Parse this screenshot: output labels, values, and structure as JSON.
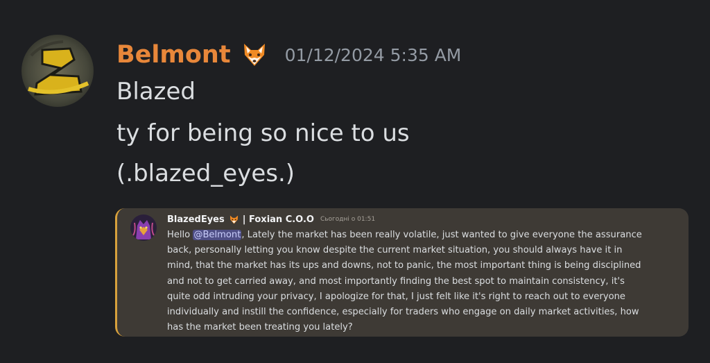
{
  "message": {
    "author": "Belmont",
    "badge_icon": "fox-emoji-icon",
    "timestamp": "01/12/2024 5:35 AM",
    "lines": [
      "Blazed",
      "ty for being so nice to us",
      "(.blazed_eyes.)"
    ],
    "colors": {
      "author": "#e8873a",
      "text": "#dbdee1",
      "timestamp": "#949ba4",
      "background": "#1e1f22"
    }
  },
  "embed": {
    "author": "BlazedEyes",
    "author_icon": "fox-emoji-icon",
    "role": "| Foxian C.O.O",
    "time": "Сьогодні о 01:51",
    "greeting": "Hello ",
    "mention": "@Belmont",
    "body_lines": [
      ", Lately the market has been really volatile, just wanted to give everyone the assurance",
      "back, personally letting you know despite the current market situation, you should always have it in",
      "mind, that the market has its ups and downs, not to panic, the most important thing is being disciplined",
      "and not to get carried away, and most importantly finding the best spot to maintain consistency, it's",
      "quite odd intruding your privacy, I apologize for that, I just felt like it's right to reach out to everyone",
      "individually and instill the confidence, especially for traders who engage on daily market activities, how",
      "has the market been treating you lately?"
    ],
    "colors": {
      "background": "#3e3a35",
      "accent_border": "#d8a13c",
      "mention_bg": "#4f4f86",
      "mention_text": "#c9cdfb"
    }
  }
}
